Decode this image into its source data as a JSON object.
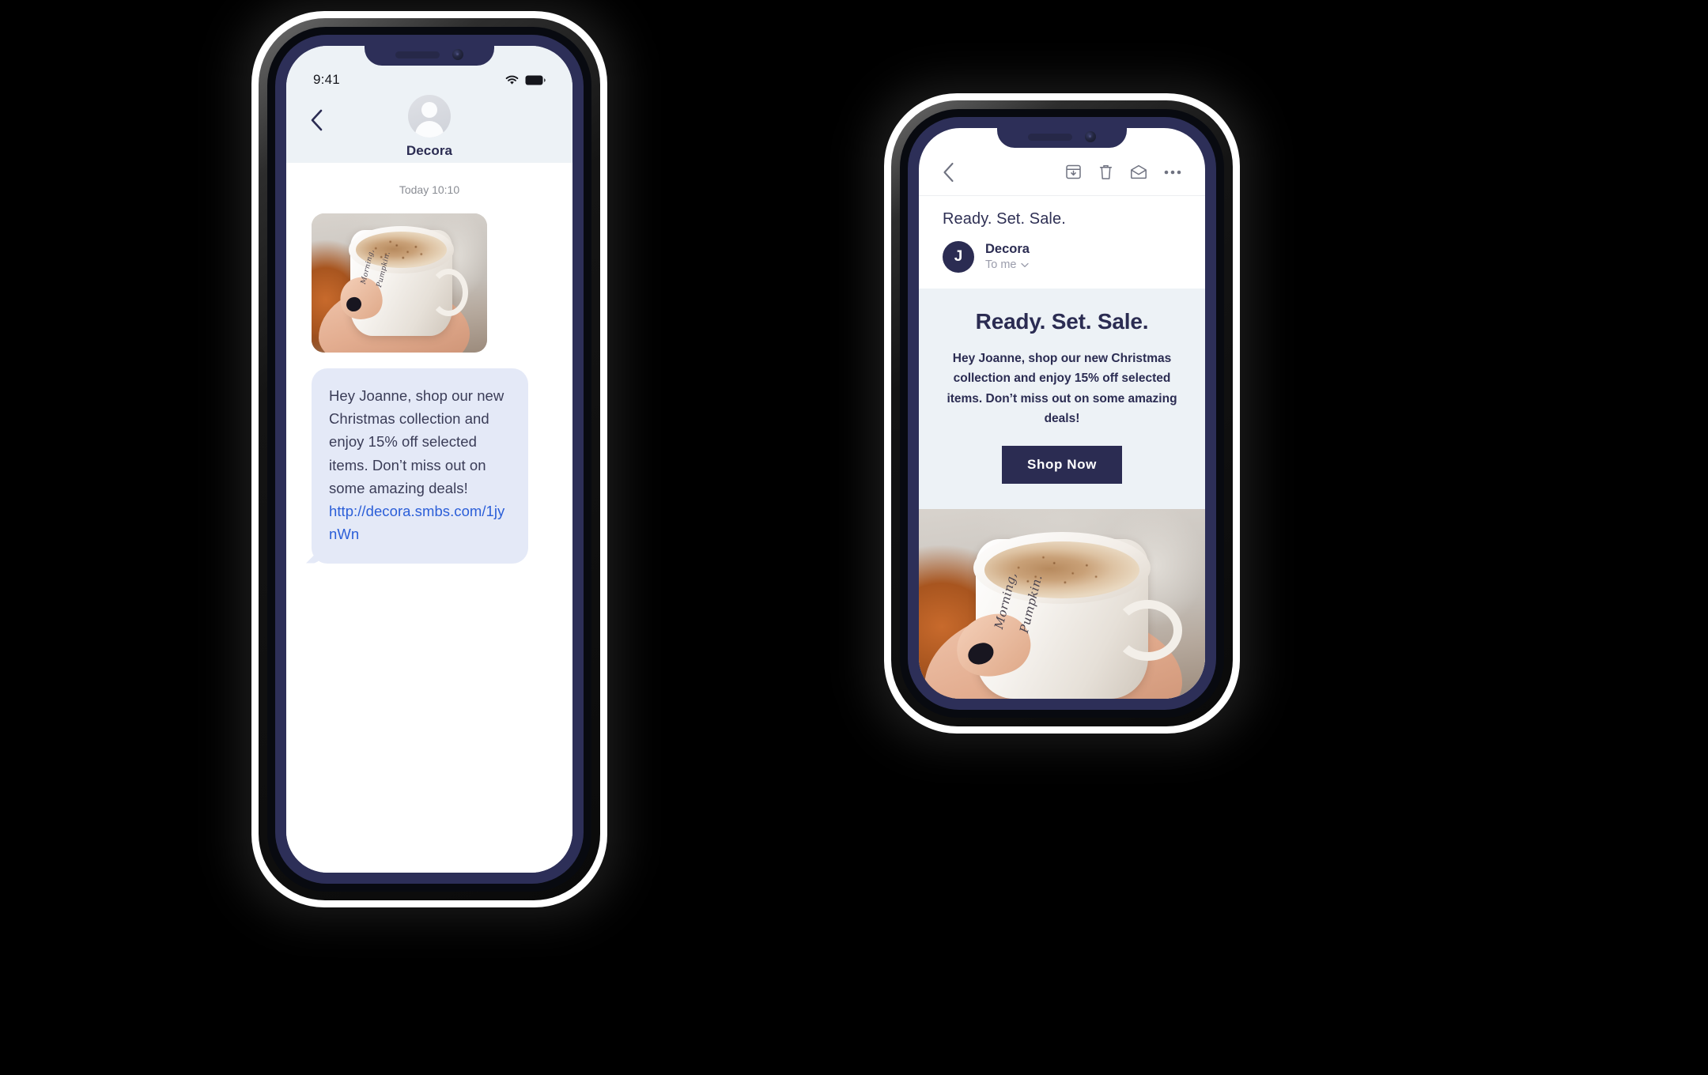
{
  "scene": {
    "background_color": "#000000",
    "accent_navy": "#2b2c52",
    "bubble_bg": "#e4e9f7",
    "link_color": "#2b5ed8",
    "promo_bg": "#edf2f6"
  },
  "phone_sms": {
    "device_name": "smartphone-sms",
    "status_bar": {
      "time": "9:41",
      "wifi_icon": "wifi-icon",
      "battery_icon": "battery-full-icon"
    },
    "navbar": {
      "back_icon": "chevron-left-icon",
      "avatar_icon": "person-avatar-icon",
      "contact_name": "Decora"
    },
    "conversation": {
      "timestamp": "Today 10:10",
      "image_attachment": {
        "name": "coffee-mug-photo",
        "mug_text_line1": "Morning,",
        "mug_text_line2": "Pumpkin."
      },
      "message": {
        "text": "Hey Joanne, shop our new Christmas collection and enjoy 15% off selected items. Don’t miss out on some amazing deals!",
        "link": "http://decora.smbs.com/1jynWn"
      }
    }
  },
  "phone_email": {
    "device_name": "smartphone-email",
    "toolbar": {
      "back_icon": "chevron-left-icon",
      "archive_icon": "archive-icon",
      "delete_icon": "trash-icon",
      "unread_icon": "envelope-icon",
      "more_icon": "more-horizontal-icon"
    },
    "message_header": {
      "subject": "Ready. Set. Sale.",
      "sender_initial": "J",
      "sender_name": "Decora",
      "recipient": "To me",
      "expand_icon": "chevron-down-icon"
    },
    "promo": {
      "title": "Ready. Set. Sale.",
      "body": "Hey Joanne, shop our new Christmas collection and enjoy 15% off selected items. Don’t miss out on some amazing deals!",
      "cta_label": "Shop Now",
      "hero_image": {
        "name": "coffee-mug-hero-photo",
        "mug_text_line1": "Morning,",
        "mug_text_line2": "Pumpkin."
      }
    }
  }
}
